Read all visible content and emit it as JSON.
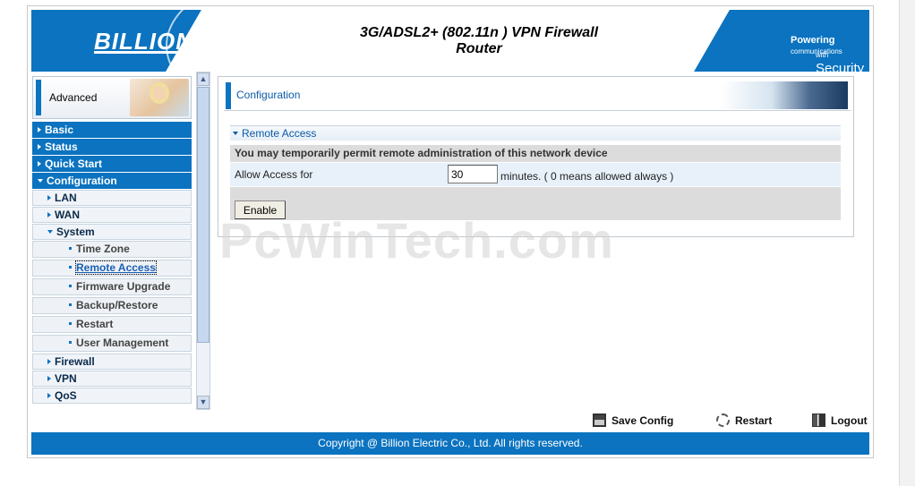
{
  "header": {
    "logo": "BILLION",
    "title_line1": "3G/ADSL2+ (802.11n ) VPN Firewall",
    "title_line2": "Router",
    "tag_powering": "Powering",
    "tag_communications": "communications",
    "tag_with": "with",
    "tag_security": "Security",
    "brand_color": "#0b73c0"
  },
  "sidebar": {
    "advanced_label": "Advanced",
    "menu": {
      "basic": "Basic",
      "status": "Status",
      "quick_start": "Quick Start",
      "configuration": "Configuration",
      "lan": "LAN",
      "wan": "WAN",
      "system": "System",
      "time_zone": "Time Zone",
      "remote_access": "Remote Access",
      "firmware_upgrade": "Firmware Upgrade",
      "backup_restore": "Backup/Restore",
      "restart": "Restart",
      "user_management": "User Management",
      "firewall": "Firewall",
      "vpn": "VPN",
      "qos": "QoS"
    }
  },
  "main": {
    "page_title": "Configuration",
    "section_title": "Remote Access",
    "info_text": "You may temporarily permit remote administration of this network device",
    "allow_label": "Allow Access for",
    "minutes_value": "30",
    "minutes_suffix": "minutes. ( 0 means allowed always )",
    "enable_label": "Enable"
  },
  "watermark": "PcWinTech.com",
  "actions": {
    "save_config": "Save Config",
    "restart": "Restart",
    "logout": "Logout"
  },
  "footer": {
    "copyright": "Copyright @ Billion Electric Co., Ltd. All rights reserved."
  }
}
